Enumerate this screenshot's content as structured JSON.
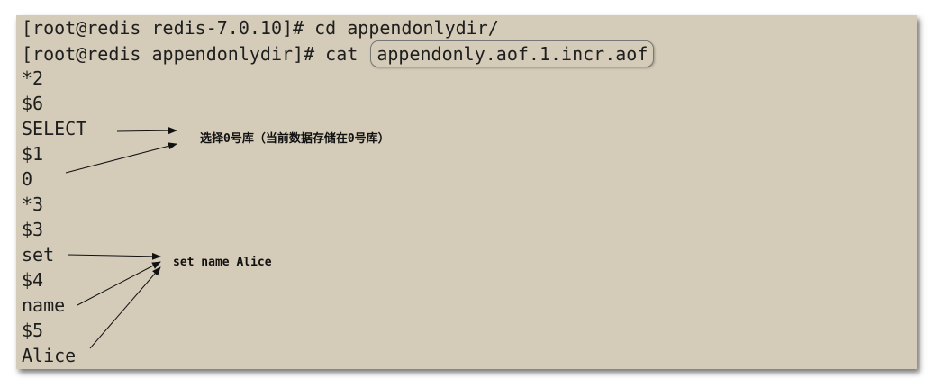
{
  "terminal": {
    "lines": [
      "[root@redis redis-7.0.10]# cd appendonlydir/",
      "[root@redis appendonlydir]# cat",
      "*2",
      "$6",
      "SELECT",
      "$1",
      "0",
      "*3",
      "$3",
      "set",
      "$4",
      "name",
      "$5",
      "Alice"
    ],
    "highlighted_file": "appendonly.aof.1.incr.aof"
  },
  "annotations": {
    "select_note": "选择0号库（当前数据存储在0号库）",
    "set_note": "set name Alice"
  },
  "colors": {
    "terminal_background": "#d4cbb8",
    "text": "#1e1e1e"
  }
}
